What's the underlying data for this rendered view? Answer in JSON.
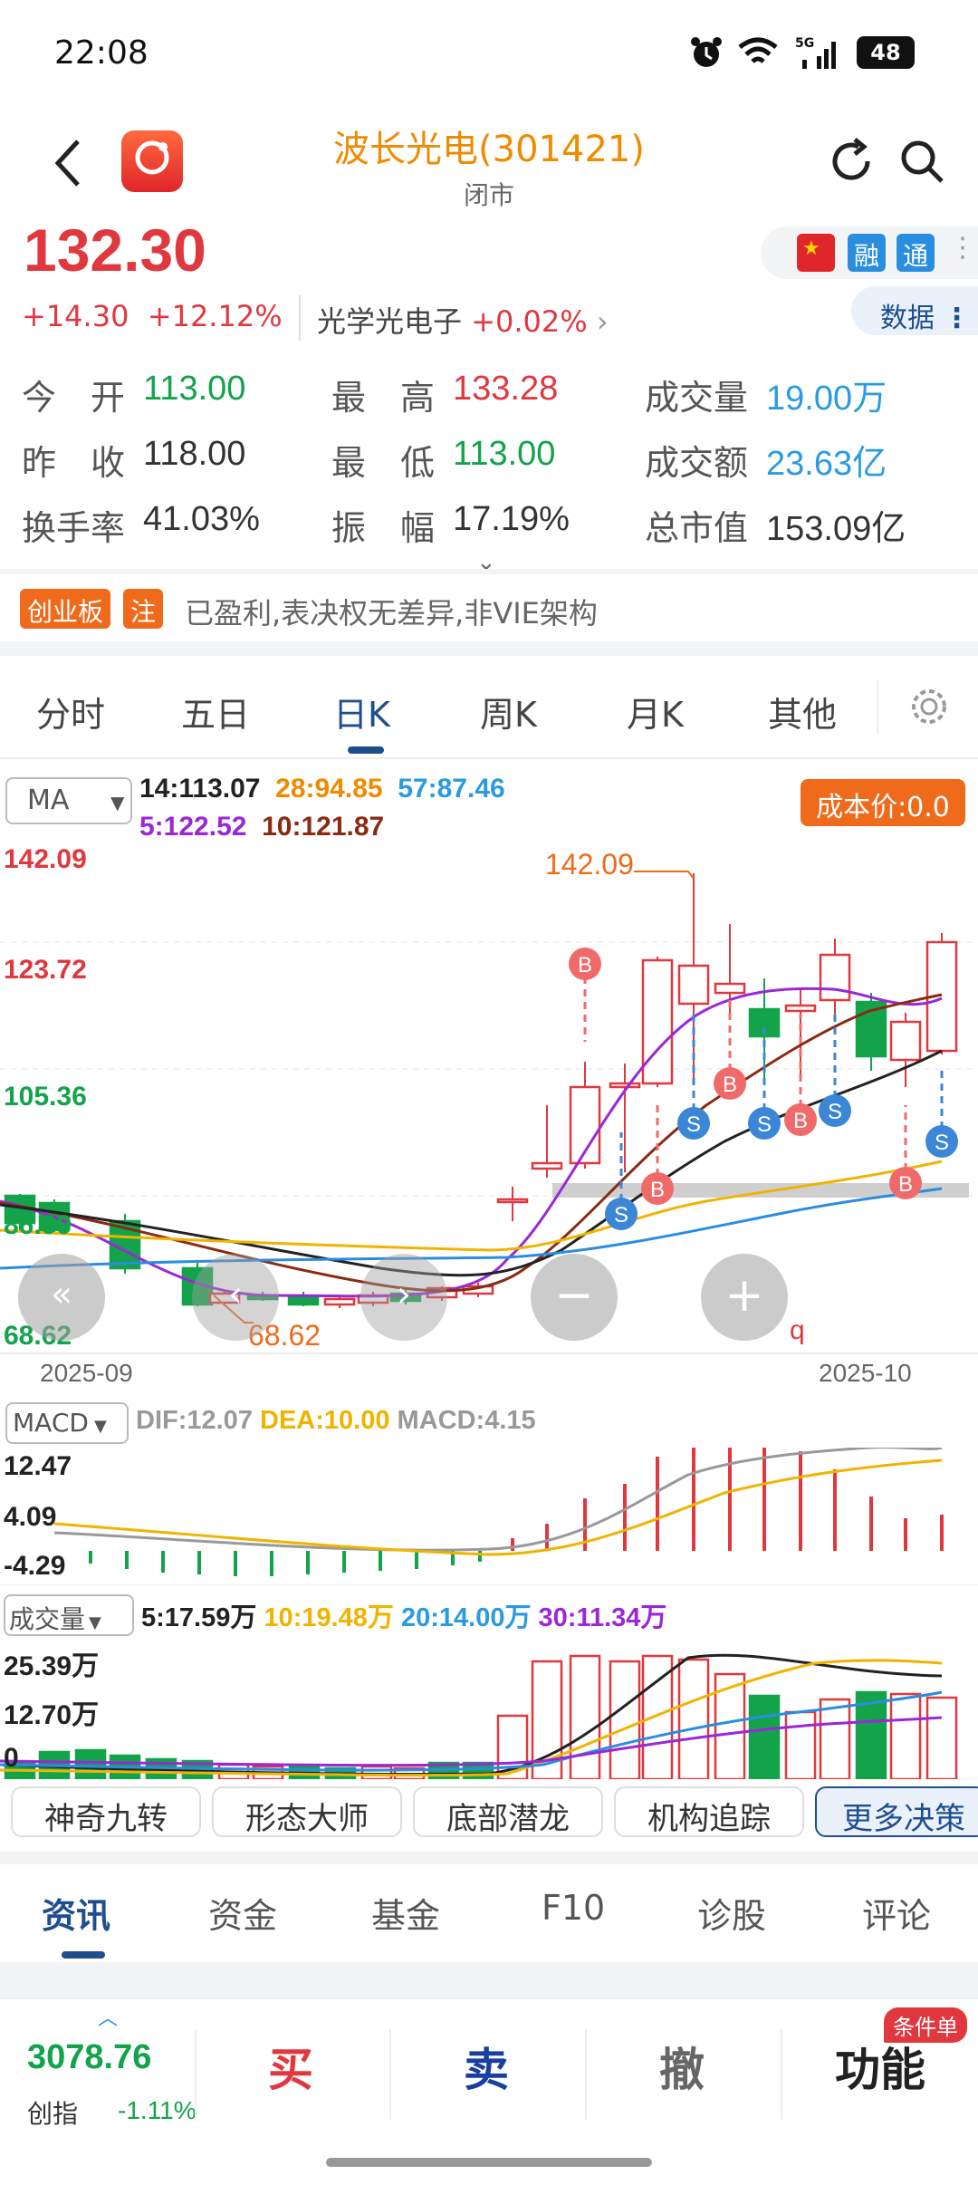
{
  "status": {
    "time": "22:08",
    "battery": "48"
  },
  "header": {
    "title": "波长光电(301421)",
    "subtitle": "闭市",
    "badges": [
      "融",
      "通"
    ],
    "data_tab": "数据"
  },
  "quote": {
    "price": "132.30",
    "change": "+14.30",
    "pct": "+12.12%",
    "sector": "光学光电子",
    "sector_pct": "+0.02%"
  },
  "stats": [
    {
      "label": "今　开",
      "value": "113.00",
      "color": "green"
    },
    {
      "label": "最　高",
      "value": "133.28",
      "color": "red"
    },
    {
      "label": "成交量",
      "value": "19.00万",
      "color": "blue"
    },
    {
      "label": "昨　收",
      "value": "118.00",
      "color": "dark"
    },
    {
      "label": "最　低",
      "value": "113.00",
      "color": "green"
    },
    {
      "label": "成交额",
      "value": "23.63亿",
      "color": "blue"
    },
    {
      "label": "换手率",
      "value": "41.03%",
      "color": "dark"
    },
    {
      "label": "振　幅",
      "value": "17.19%",
      "color": "dark"
    },
    {
      "label": "总市值",
      "value": "153.09亿",
      "color": "dark"
    }
  ],
  "tags": {
    "board": "创业板",
    "note": "注",
    "desc": "已盈利,表决权无差异,非VIE架构"
  },
  "chart_tabs": [
    "分时",
    "五日",
    "日K",
    "周K",
    "月K",
    "其他"
  ],
  "active_tab": "日K",
  "kline": {
    "selector": "MA",
    "ma14": "14:113.07",
    "ma28": "28:94.85",
    "ma57": "57:87.46",
    "ma5": "5:122.52",
    "ma10": "10:121.87",
    "cost_btn": "成本价:0.0",
    "y_labels": [
      "142.09",
      "123.72",
      "105.36",
      "86.99",
      "68.62"
    ],
    "high_label": "142.09",
    "low_label": "68.62",
    "x_labels": [
      "2025-09",
      "2025-10"
    ],
    "q": "q"
  },
  "macd": {
    "selector": "MACD",
    "dif": "DIF:12.07",
    "dea": "DEA:10.00",
    "macd": "MACD:4.15",
    "y_labels": [
      "12.47",
      "4.09",
      "-4.29"
    ]
  },
  "volume": {
    "selector": "成交量",
    "v5": "5:17.59万",
    "v10": "10:19.48万",
    "v20": "20:14.00万",
    "v30": "30:11.34万",
    "y_labels": [
      "25.39万",
      "12.70万",
      "0"
    ]
  },
  "tools": [
    "神奇九转",
    "形态大师",
    "底部潜龙",
    "机构追踪",
    "更多决策"
  ],
  "bottom_tabs": [
    "资讯",
    "资金",
    "基金",
    "F10",
    "诊股",
    "评论"
  ],
  "footer": {
    "index_value": "3078.76",
    "index_name": "创指",
    "index_pct": "-1.11%",
    "buy": "买",
    "sell": "卖",
    "cancel": "撤",
    "func": "功能",
    "badge": "条件单"
  },
  "chart_data": {
    "type": "candlestick",
    "x_range": [
      "2025-09",
      "2025-10"
    ],
    "ylim": [
      68.62,
      142.09
    ],
    "labeled_points": [
      {
        "label": "high",
        "value": 142.09
      },
      {
        "label": "low",
        "value": 68.62
      }
    ]
  }
}
